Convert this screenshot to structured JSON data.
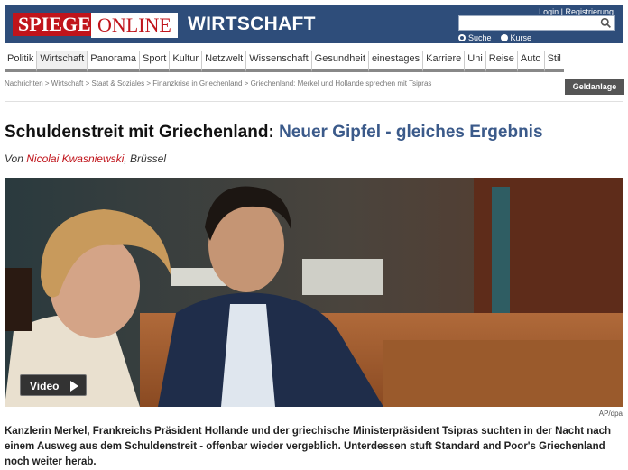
{
  "header": {
    "logo_spiegel": "SPIEGEL",
    "logo_online": "ONLINE",
    "section_title": "WIRTSCHAFT",
    "login": "Login",
    "register": "Registrierung",
    "search_placeholder": "",
    "search_opt_1": "Suche",
    "search_opt_2": "Kurse",
    "brand_color": "#2e4d7a",
    "logo_red": "#c0141b"
  },
  "nav": {
    "items": [
      "Politik",
      "Wirtschaft",
      "Panorama",
      "Sport",
      "Kultur",
      "Netzwelt",
      "Wissenschaft",
      "Gesundheit",
      "einestages",
      "Karriere",
      "Uni",
      "Reise",
      "Auto",
      "Stil"
    ],
    "active_index": 1
  },
  "breadcrumb": "Nachrichten > Wirtschaft > Staat & Soziales > Finanzkrise in Griechenland > Griechenland: Merkel und Hollande sprechen mit Tsipras",
  "geldanlage_label": "Geldanlage",
  "article": {
    "headline_main": "Schuldenstreit mit Griechenland:",
    "headline_sub": "Neuer Gipfel - gleiches Ergebnis",
    "byline_prefix": "Von",
    "author": "Nicolai Kwasniewski",
    "location": ", Brüssel",
    "video_label": "Video",
    "photo_credit": "AP/dpa",
    "teaser": "Kanzlerin Merkel, Frankreichs Präsident Hollande und der griechische Ministerpräsident Tsipras suchten in der Nacht nach einem Ausweg aus dem Schuldenstreit - offenbar wieder vergeblich. Unterdessen stuft Standard and Poor's Griechenland noch weiter herab."
  }
}
